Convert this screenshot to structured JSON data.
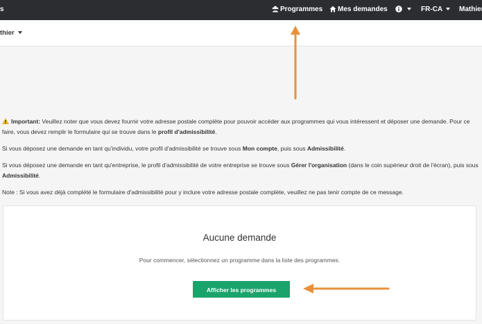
{
  "topbar": {
    "brand": "s",
    "programmes_label": "Programmes",
    "mes_demandes_label": "Mes demandes",
    "language_label": "FR-CA",
    "user_label": "Mathier"
  },
  "subbar": {
    "user_label": "thier"
  },
  "notice": {
    "p1_strong": "Important:",
    "p1_text": " Veuillez noter que vous devez fournir votre adresse postale complète pour pouvoir accéder aux programmes qui vous intéressent et déposer une demande. Pour ce faire, vous devez remplir le formulaire qui se trouve dans le ",
    "p1_link": "profil d'admissibilité",
    "p1_end": ".",
    "p2_text": "Si vous déposez une demande en tant qu'individu, votre profil d'admissibilité se trouve sous ",
    "p2_b1": "Mon compte",
    "p2_mid": ", puis sous ",
    "p2_b2": "Admissibilité",
    "p2_end": ".",
    "p3_text": "Si vous déposez une demande en tant qu'entreprise, le profil d'admissibilité de votre entreprise se trouve sous ",
    "p3_b1": "Gérer l'organisation",
    "p3_mid": " (dans le coin supérieur droit de l'écran), puis sous ",
    "p3_b2": "Admissibilité",
    "p3_end": ".",
    "p4_text": "Note : Si vous avez déjà complété le formulaire d'admissibilité pour y inclure votre adresse postale complète, veuillez ne pas tenir compte de ce message."
  },
  "card": {
    "title": "Aucune demande",
    "text": "Pour commencer, sélectionnez un programme dans la liste des programmes.",
    "button_label": "Afficher les programmes"
  },
  "colors": {
    "topbar": "#2b2d31",
    "button": "#1aa46b",
    "arrow": "#e8913a"
  },
  "icons": {
    "programmes": "programmes-icon",
    "mes_demandes": "home-icon",
    "info": "info-icon",
    "warning": "warning-icon"
  }
}
